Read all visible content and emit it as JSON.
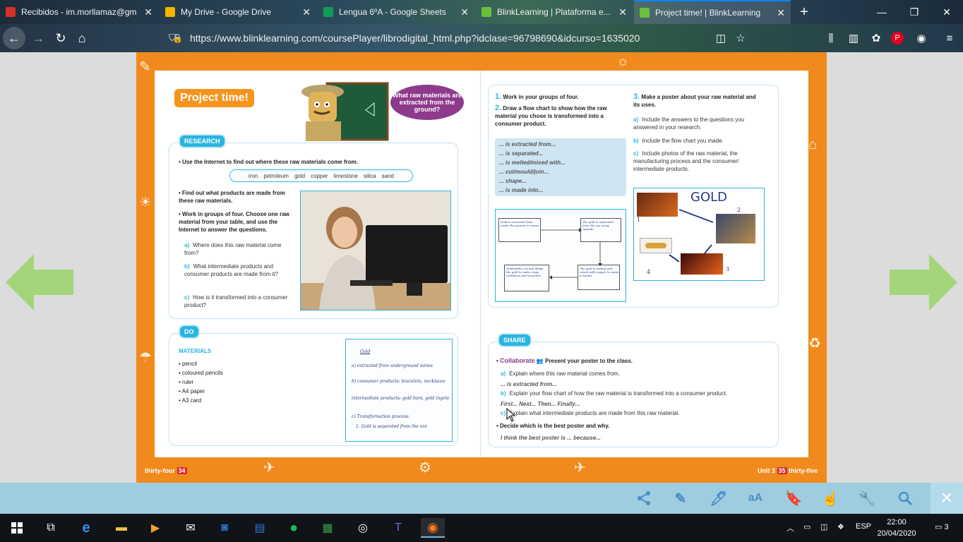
{
  "browser": {
    "tabs": [
      {
        "label": "Recibidos - im.morllamaz@gm",
        "favicon_color": "#d93025"
      },
      {
        "label": "My Drive - Google Drive",
        "favicon_color": "#f4b400"
      },
      {
        "label": "Lengua 6ºA - Google Sheets",
        "favicon_color": "#0f9d58"
      },
      {
        "label": "BlinkLearning | Plataforma e...",
        "favicon_color": "#6cbf3a"
      },
      {
        "label": "Project time! | BlinkLearning",
        "favicon_color": "#6cbf3a"
      }
    ],
    "new_tab": "+",
    "url": "https://www.blinklearning.com/coursePlayer/librodigital_html.php?idclase=96798690&idcurso=1635020"
  },
  "left_page": {
    "title": "Project time!",
    "bubble": "What raw materials are extracted from the ground?",
    "research_tag": "RESEARCH",
    "research_intro": "Use the Internet to find out where these raw materials come from.",
    "words": [
      "iron",
      "petroleum",
      "gold",
      "copper",
      "limestone",
      "silica",
      "sand"
    ],
    "bullet_find": "Find out what products are made from these raw materials.",
    "bullet_work": "Work in groups of four. Choose one raw material from your table, and use the Internet to answer the questions.",
    "questions": [
      {
        "letter": "a)",
        "text": "Where does this raw material come from?"
      },
      {
        "letter": "b)",
        "text": "What intermediate products and consumer products are made from it?"
      },
      {
        "letter": "c)",
        "text": "How is it transformed into a consumer product?"
      }
    ],
    "do_tag": "DO",
    "materials_heading": "MATERIALS",
    "materials": [
      "• pencil",
      "• coloured pencils",
      "• ruler",
      "• A4 paper",
      "• A3 card"
    ],
    "handwriting": {
      "title": "Gold",
      "lines": [
        "a) extracted from underground mines",
        "b) consumer products: bracelets, necklaces",
        "intermediate products: gold bars, gold ingots",
        "c) Transformation process:",
        "1. Gold is separated from the ore"
      ]
    },
    "footer": "thirty-four",
    "page_number": "34"
  },
  "right_page": {
    "step1_num": "1.",
    "step1": "Work in your groups of four.",
    "step2_num": "2.",
    "step2": "Draw a flow chart to show how the raw material you chose is transformed into a consumer product.",
    "prompts": [
      "... is extracted from...",
      "... is separated...",
      "... is melted/mixed with...",
      "... cut/mould/join...",
      "... shape...",
      "... is made into..."
    ],
    "flow_boxes": [
      "Gold is extracted from under the ground in mines",
      "The gold is separated from the ore using cyanide",
      "The gold is melted and mixed with copper to make it harder",
      "Goldsmiths cut and shape the gold to make rings, necklaces and bracelets"
    ],
    "step3_num": "3.",
    "step3": "Make a poster about your raw material and its uses.",
    "step3_items": [
      {
        "letter": "a)",
        "text": "Include the answers to the questions you answered in your research."
      },
      {
        "letter": "b)",
        "text": "Include the flow chart you made."
      },
      {
        "letter": "c)",
        "text": "Include photos of the raw material, the manufacturing process and the consumer/ intermediate products."
      }
    ],
    "poster_title": "GOLD",
    "poster_numbers": [
      "1",
      "2",
      "3",
      "4"
    ],
    "share_tag": "SHARE",
    "collaborate": "Collaborate",
    "collaborate_text": "Present your poster to the class.",
    "share_items": [
      {
        "letter": "a)",
        "text": "Explain where this raw material comes from."
      },
      {
        "letter": "b)",
        "text": "Explain your flow chart of how the raw material is transformed into a consumer product."
      },
      {
        "letter": "c)",
        "text": "Explain what intermediate products are made from this raw material."
      }
    ],
    "share_hint_a": "... is extracted from...",
    "share_hint_b": "First... Next... Then... Finally...",
    "decide": "Decide which is the best poster and why.",
    "decide_hint": "I think the best poster is ... because...",
    "footer_unit": "Unit 3",
    "page_number": "35",
    "footer": "thirty-five"
  },
  "reader_tools": [
    "share-icon",
    "pencil-icon",
    "marker-icon",
    "text-size-icon",
    "bookmark-icon",
    "hand-icon",
    "wrench-icon",
    "search-icon"
  ],
  "reader_labels": {
    "text_size": "aA"
  },
  "taskbar": {
    "language": "ESP",
    "time": "22:00",
    "date": "20/04/2020",
    "notifications": "3"
  }
}
